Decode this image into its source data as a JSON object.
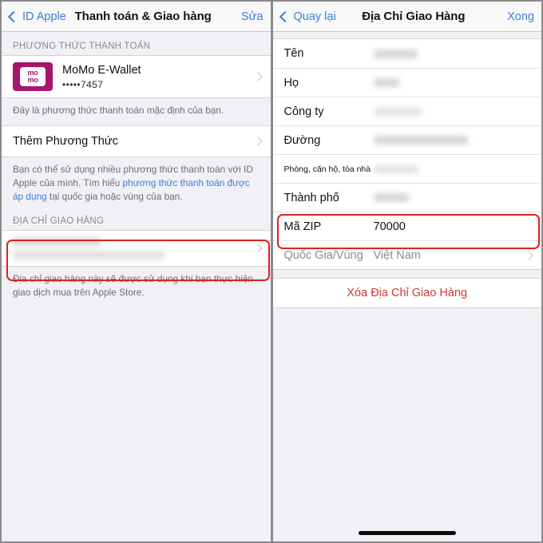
{
  "colors": {
    "accent_blue": "#3b7dd8",
    "highlight_red": "#e02020",
    "destructive_red": "#cc3b33",
    "momo_magenta": "#a7156b",
    "group_background": "#f0f0f5"
  },
  "left_panel": {
    "navbar": {
      "back_label": "ID Apple",
      "title": "Thanh toán & Giao hàng",
      "action_label": "Sửa"
    },
    "payment_section": {
      "header": "PHƯƠNG THỨC THANH TOÁN",
      "method": {
        "logo_text_line1": "mo",
        "logo_text_line2": "mo",
        "name": "MoMo E-Wallet",
        "masked_number": "•••••7457"
      },
      "footnote": "Đây là phương thức thanh toán mặc định của bạn."
    },
    "add_method": {
      "label": "Thêm Phương Thức",
      "footnote_part1": "Bạn có thể sử dụng nhiều phương thức thanh toán với ID Apple của mình. Tìm hiểu ",
      "footnote_link": "phương thức thanh toán được áp dụng",
      "footnote_part2": " tại quốc gia hoặc vùng của bạn."
    },
    "shipping_section": {
      "header": "ĐỊA CHỈ GIAO HÀNG",
      "address_redacted": true,
      "footnote": "Địa chỉ giao hàng này sẽ được sử dụng khi bạn thực hiện giao dịch mua trên Apple Store."
    }
  },
  "right_panel": {
    "navbar": {
      "back_label": "Quay lại",
      "title": "Địa Chỉ Giao Hàng",
      "action_label": "Xong"
    },
    "fields": [
      {
        "label": "Tên",
        "value": "",
        "redacted": true,
        "label_size": "normal",
        "blur_width": 55
      },
      {
        "label": "Họ",
        "value": "",
        "redacted": true,
        "label_size": "normal",
        "blur_width": 32
      },
      {
        "label": "Công ty",
        "value": "",
        "redacted": true,
        "label_size": "normal",
        "blur_width": 60,
        "light": true
      },
      {
        "label": "Đường",
        "value": "",
        "redacted": true,
        "label_size": "normal",
        "blur_width": 118
      },
      {
        "label": "Phòng, căn hộ, tòa nhà",
        "value": "",
        "redacted": true,
        "label_size": "small",
        "blur_width": 56,
        "light": true
      },
      {
        "label": "Thành phố",
        "value": "",
        "redacted": true,
        "label_size": "normal",
        "blur_width": 44
      },
      {
        "label": "Mã ZIP",
        "value": "70000",
        "redacted": false,
        "label_size": "normal",
        "highlighted": true
      },
      {
        "label": "Quốc Gia/Vùng",
        "value": "Việt Nam",
        "redacted": false,
        "label_size": "normal",
        "muted": true,
        "chevron": true
      }
    ],
    "delete_button_label": "Xóa Địa Chỉ Giao Hàng"
  }
}
